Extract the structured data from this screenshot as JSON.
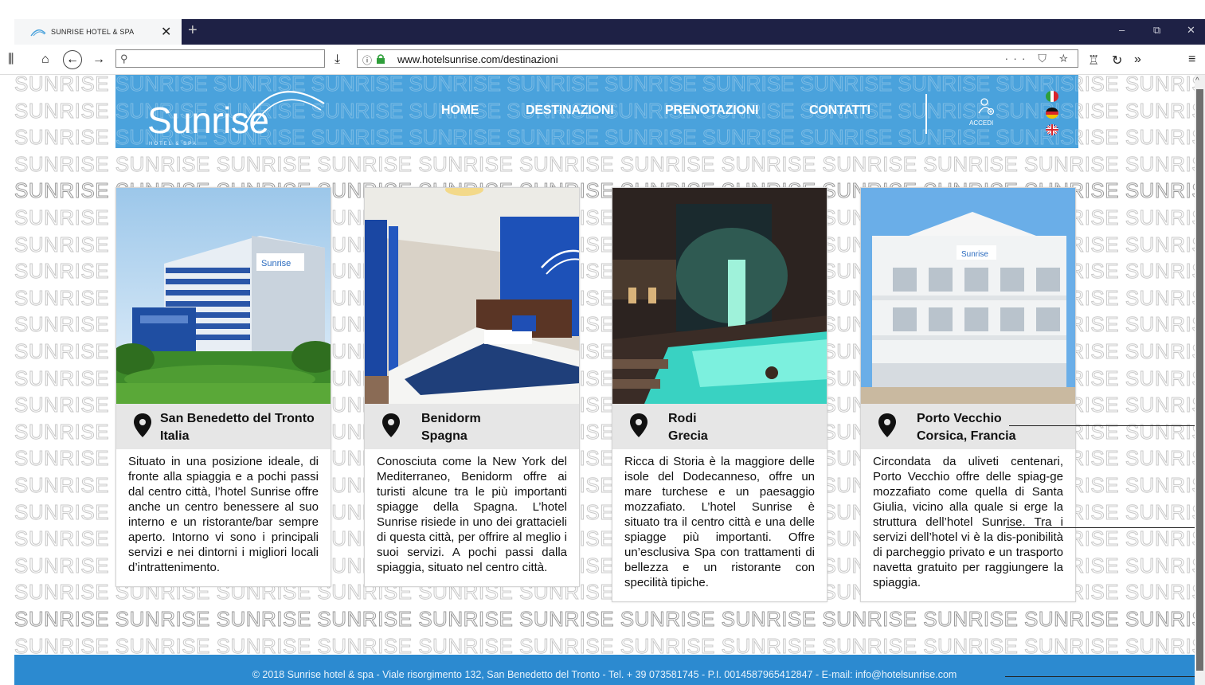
{
  "browser": {
    "tab_title": "SUNRISE HOTEL & SPA",
    "tab_close": "✕",
    "new_tab": "+",
    "url": "www.hotelsunrise.com/destinazioni",
    "url_right_icons": "··· ⛉ ☆",
    "controls": {
      "minimize": "–",
      "restore": "⧉",
      "close": "✕"
    }
  },
  "watermark_word": "SUNRISE",
  "header": {
    "logo": "Sunrise",
    "logo_sub": "HOTEL & SPA",
    "menu": [
      "HOME",
      "DESTINAZIONI",
      "PRENOTAZIONI",
      "CONTATTI"
    ],
    "login_label": "ACCEDI",
    "languages": [
      "italian-flag",
      "german-flag",
      "uk-flag"
    ]
  },
  "cards": [
    {
      "city": "San Benedetto del Tronto",
      "country": "Italia",
      "text": "Situato in una posizione ideale, di fronte alla spiaggia e a pochi passi dal centro città, l’hotel Sunrise offre anche un centro benessere al suo interno e un ristorante/bar sempre aperto. Intorno vi sono i principali servizi e nei dintorni i migliori locali d’intrattenimento.",
      "image": "hotel-building-photo"
    },
    {
      "city": "Benidorm",
      "country": "Spagna",
      "text": "Conosciuta come la New York del Mediterraneo, Benidorm offre ai turisti alcune tra le più importanti spiagge della Spagna. L’hotel Sunrise risiede in uno dei grattacieli di questa città, per offrire al meglio i suoi servizi. A pochi passi dalla spiaggia, situato nel centro città.",
      "image": "hotel-room-photo"
    },
    {
      "city": "Rodi",
      "country": "Grecia",
      "text": "Ricca di Storia è la maggiore delle isole del Dodecanneso, offre un mare turchese e un paesaggio mozzafiato. L’hotel Sunrise è situato tra il centro città e una delle spiagge più importanti. Offre un’esclusiva Spa con trattamenti di bellezza e un ristorante con specilità tipiche.",
      "image": "spa-pool-photo"
    },
    {
      "city": "Porto Vecchio",
      "country": "Corsica, Francia",
      "text": "Circondata da uliveti centenari, Porto Vecchio offre delle spiag-ge mozzafiato come quella di Santa Giulia, vicino alla quale si erge la struttura dell’hotel Sunrise. Tra i servizi dell’hotel vi è la dis-ponibilità di parcheggio privato e un trasporto navetta gratuito per raggiungere la spiaggia.",
      "image": "white-hotel-photo"
    }
  ],
  "footer": {
    "text": "© 2018 Sunrise hotel & spa - Viale risorgimento 132, San Benedetto del Tronto - Tel. + 39 073581745 - P.I. 0014587965412847 - E-mail: info@hotelsunrise.com"
  },
  "colors": {
    "header_blue": "#4aa2dc",
    "footer_blue": "#2c8ad0",
    "tabbar_navy": "#1e2145",
    "location_gray": "#e6e6e6"
  }
}
